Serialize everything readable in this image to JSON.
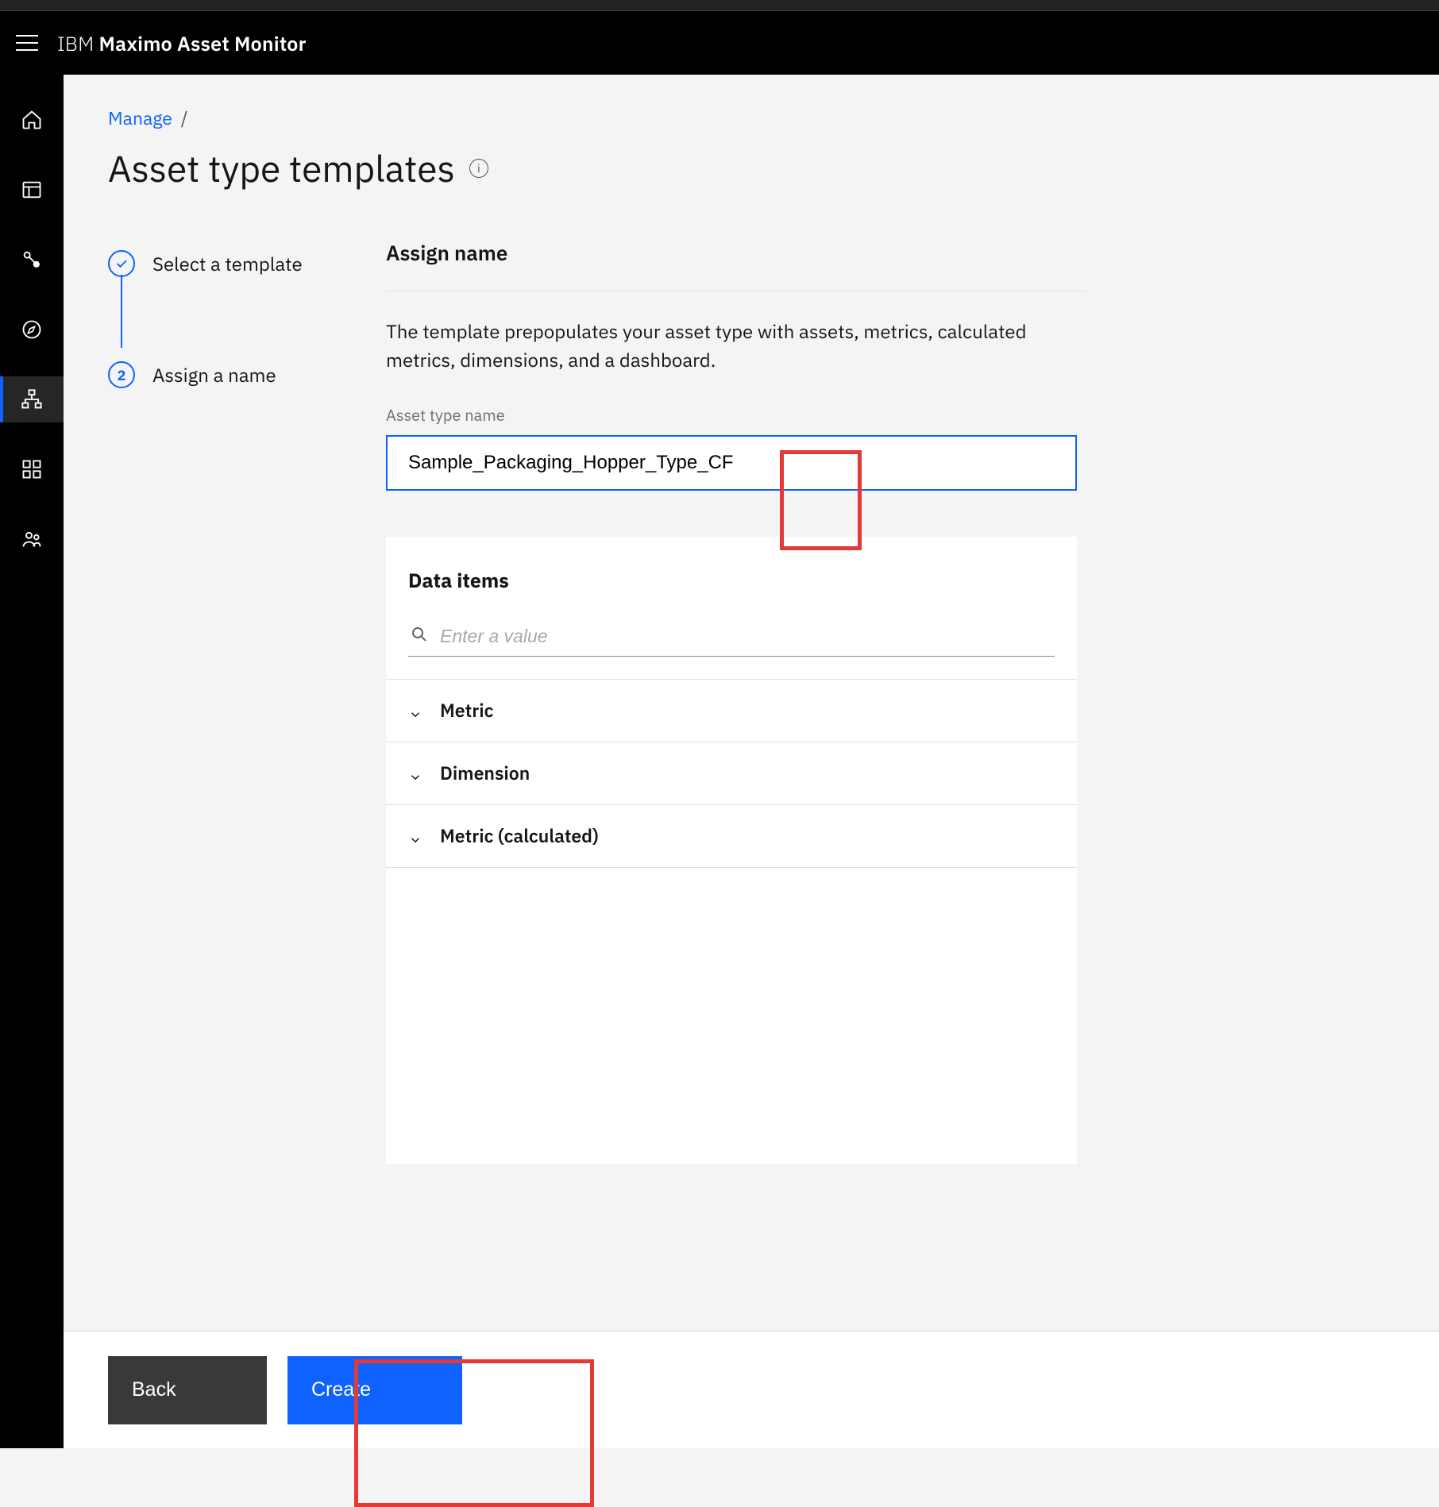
{
  "app": {
    "brand_prefix": "IBM ",
    "brand_main": "Maximo Asset Monitor"
  },
  "breadcrumb": {
    "parent": "Manage",
    "sep": "/"
  },
  "page": {
    "title": "Asset type templates"
  },
  "stepper": {
    "step1": {
      "label": "Select a template",
      "mark": "✓"
    },
    "step2": {
      "label": "Assign a name",
      "num": "2"
    }
  },
  "form": {
    "section_title": "Assign name",
    "helper": "The template prepopulates your asset type with assets, metrics, calculated metrics, dimensions, and a dashboard.",
    "field_label": "Asset type name",
    "field_value": "Sample_Packaging_Hopper_Type_CF"
  },
  "card": {
    "title": "Data items",
    "search_placeholder": "Enter a value",
    "items": [
      {
        "label": "Metric"
      },
      {
        "label": "Dimension"
      },
      {
        "label": "Metric (calculated)"
      }
    ]
  },
  "footer": {
    "back": "Back",
    "create": "Create"
  }
}
